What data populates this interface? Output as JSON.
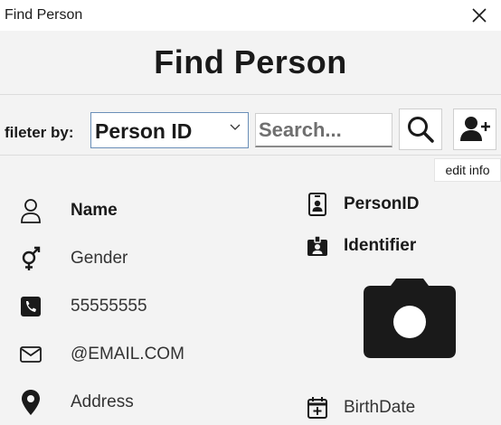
{
  "window": {
    "title": "Find Person"
  },
  "header": {
    "title": "Find Person"
  },
  "toolbar": {
    "filter_label": "fileter by:",
    "filter_value": "Person ID",
    "search_placeholder": "Search...",
    "tooltip": "edit info"
  },
  "details": {
    "name": "Name",
    "gender": "Gender",
    "phone": "55555555",
    "email": "@EMAIL.COM",
    "address": "Address",
    "person_id": "PersonID",
    "identifier": "Identifier",
    "birthdate": "BirthDate"
  },
  "icons": {
    "close": "close-icon",
    "chevron": "chevron-down-icon",
    "search": "search-icon",
    "add_person": "add-person-icon",
    "person": "person-icon",
    "gender": "gender-icon",
    "phone": "phone-icon",
    "email": "envelope-icon",
    "address": "location-pin-icon",
    "badge": "id-badge-icon",
    "id_card": "id-card-icon",
    "calendar": "calendar-add-icon",
    "camera": "camera-icon"
  },
  "colors": {
    "background": "#f3f3f3",
    "accent_border": "#6a8fb8",
    "text": "#1a1a1a"
  }
}
